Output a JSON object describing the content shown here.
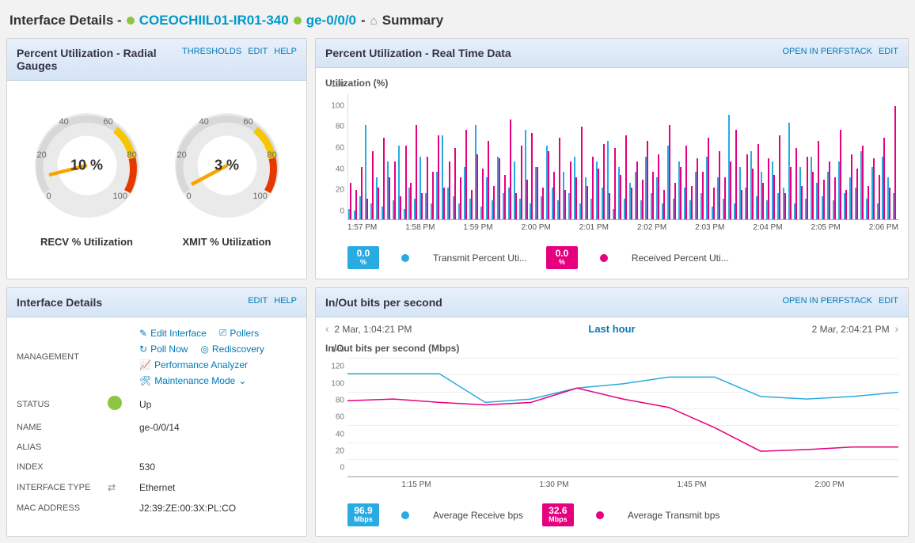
{
  "breadcrumb": {
    "prefix": "Interface Details -",
    "node": "COEOCHIIL01-IR01-340",
    "interface": "ge-0/0/0",
    "sep": "-",
    "page": "Summary"
  },
  "gauges_panel": {
    "title": "Percent Utilization - Radial Gauges",
    "actions": {
      "thresholds": "THRESHOLDS",
      "edit": "EDIT",
      "help": "HELP"
    },
    "recv": {
      "value": "10 %",
      "label": "RECV % Utilization"
    },
    "xmit": {
      "value": "3 %",
      "label": "XMIT % Utilization"
    },
    "ticks": {
      "t0": "0",
      "t20": "20",
      "t40": "40",
      "t60": "60",
      "t80": "80",
      "t100": "100"
    }
  },
  "realtime_panel": {
    "title": "Percent Utilization - Real Time Data",
    "actions": {
      "open": "OPEN IN PERFSTACK",
      "edit": "EDIT"
    },
    "small_title": "Utilization (%)",
    "y_ticks": [
      "0",
      "20",
      "40",
      "60",
      "80",
      "100",
      "120"
    ],
    "x_ticks": [
      "1:57 PM",
      "1:58 PM",
      "1:59 PM",
      "2:00 PM",
      "2:01 PM",
      "2:02 PM",
      "2:03 PM",
      "2:04 PM",
      "2:05 PM",
      "2:06 PM"
    ],
    "legend": {
      "tx_val": "0.0",
      "tx_unit": "%",
      "tx_label": "Transmit Percent Uti...",
      "rx_val": "0.0",
      "rx_unit": "%",
      "rx_label": "Received Percent Uti..."
    }
  },
  "details_panel": {
    "title": "Interface Details",
    "actions": {
      "edit": "EDIT",
      "help": "HELP"
    },
    "mgmt_label": "MANAGEMENT",
    "links": {
      "edit": "Edit Interface",
      "pollers": "Pollers",
      "pollnow": "Poll Now",
      "rediscovery": "Rediscovery",
      "perf": "Performance Analyzer",
      "maint": "Maintenance Mode"
    },
    "rows": {
      "status_k": "STATUS",
      "status_v": "Up",
      "name_k": "NAME",
      "name_v": "ge-0/0/14",
      "alias_k": "ALIAS",
      "alias_v": "",
      "index_k": "INDEX",
      "index_v": "530",
      "iftype_k": "INTERFACE TYPE",
      "iftype_v": "Ethernet",
      "mac_k": "MAC ADDRESS",
      "mac_v": "J2:39:ZE:00:3X:PL:CO"
    }
  },
  "inout_panel": {
    "title": "In/Out bits per second",
    "actions": {
      "open": "OPEN IN PERFSTACK",
      "edit": "EDIT"
    },
    "nav": {
      "start": "2 Mar, 1:04:21 PM",
      "period": "Last hour",
      "end": "2 Mar, 2:04:21 PM"
    },
    "small_title": "In/Out bits per second (Mbps)",
    "y_ticks": [
      "0",
      "20",
      "40",
      "60",
      "80",
      "100",
      "120",
      "140"
    ],
    "x_ticks": [
      "1:15 PM",
      "1:30 PM",
      "1:45 PM",
      "2:00 PM"
    ],
    "legend": {
      "rx_val": "96.9",
      "rx_unit": "Mbps",
      "rx_label": "Average Receive bps",
      "tx_val": "32.6",
      "tx_unit": "Mbps",
      "tx_label": "Average Transmit bps"
    }
  },
  "chart_data": [
    {
      "type": "bar",
      "title": "Percent Utilization - Real Time Data",
      "xlabel": "",
      "ylabel": "Utilization (%)",
      "ylim": [
        0,
        120
      ],
      "x_labels": [
        "1:57 PM",
        "1:58 PM",
        "1:59 PM",
        "2:00 PM",
        "2:01 PM",
        "2:02 PM",
        "2:03 PM",
        "2:04 PM",
        "2:05 PM",
        "2:06 PM"
      ],
      "series": [
        {
          "name": "Transmit Percent Utilization",
          "color": "#29abe2",
          "values": [
            10,
            8,
            22,
            90,
            15,
            40,
            12,
            55,
            18,
            70,
            10,
            30,
            20,
            60,
            25,
            15,
            45,
            80,
            30,
            22,
            15,
            50,
            20,
            90,
            12,
            40,
            18,
            60,
            25,
            30,
            55,
            20,
            85,
            15,
            50,
            22,
            70,
            30,
            18,
            45,
            25,
            60,
            15,
            40,
            20,
            55,
            30,
            75,
            10,
            50,
            20,
            35,
            45,
            18,
            60,
            25,
            40,
            15,
            70,
            20,
            55,
            30,
            18,
            45,
            25,
            60,
            12,
            40,
            20,
            100,
            15,
            50,
            30,
            65,
            22,
            45,
            18,
            55,
            25,
            30,
            92,
            15,
            50,
            20,
            60,
            35,
            22,
            45,
            18,
            55,
            25,
            40,
            30,
            65,
            20,
            50,
            15,
            60,
            40,
            25
          ]
        },
        {
          "name": "Received Percent Utilization",
          "color": "#e6007e",
          "values": [
            35,
            28,
            50,
            20,
            65,
            30,
            78,
            40,
            55,
            22,
            70,
            35,
            90,
            25,
            60,
            45,
            80,
            30,
            55,
            68,
            40,
            85,
            28,
            62,
            48,
            75,
            32,
            58,
            42,
            95,
            25,
            70,
            38,
            82,
            50,
            30,
            65,
            45,
            78,
            28,
            55,
            40,
            88,
            32,
            60,
            48,
            72,
            25,
            68,
            42,
            80,
            30,
            55,
            38,
            75,
            45,
            62,
            28,
            90,
            35,
            50,
            70,
            32,
            58,
            45,
            78,
            30,
            65,
            40,
            55,
            85,
            28,
            62,
            48,
            72,
            35,
            58,
            42,
            80,
            25,
            50,
            68,
            32,
            60,
            45,
            75,
            38,
            55,
            40,
            85,
            28,
            62,
            48,
            70,
            32,
            58,
            42,
            78,
            30,
            108
          ]
        }
      ]
    },
    {
      "type": "line",
      "title": "In/Out bits per second",
      "xlabel": "",
      "ylabel": "Mbps",
      "ylim": [
        0,
        140
      ],
      "x": [
        "1:04",
        "1:10",
        "1:15",
        "1:20",
        "1:25",
        "1:30",
        "1:35",
        "1:40",
        "1:45",
        "1:50",
        "1:55",
        "2:00",
        "2:04"
      ],
      "series": [
        {
          "name": "Average Receive bps",
          "color": "#29abe2",
          "values": [
            122,
            122,
            122,
            88,
            92,
            105,
            110,
            118,
            118,
            95,
            92,
            95,
            100
          ]
        },
        {
          "name": "Average Transmit bps",
          "color": "#e6007e",
          "values": [
            90,
            92,
            88,
            85,
            88,
            105,
            92,
            82,
            58,
            30,
            32,
            35,
            35
          ]
        }
      ]
    }
  ]
}
